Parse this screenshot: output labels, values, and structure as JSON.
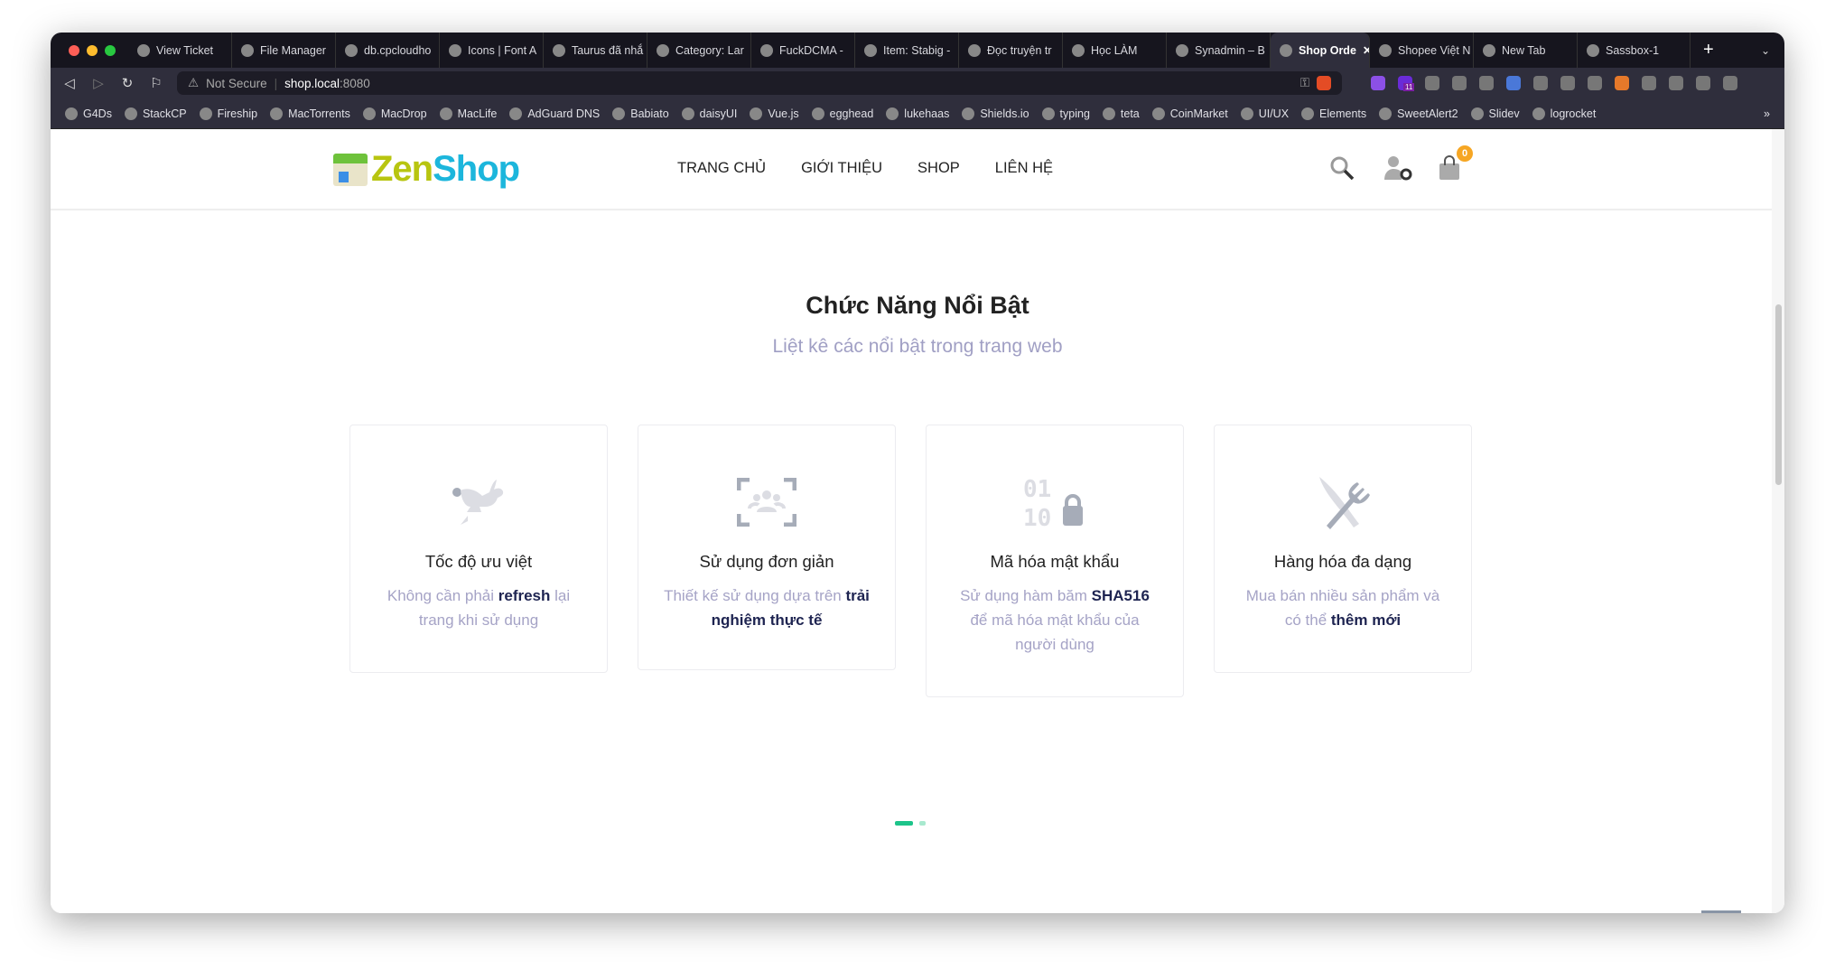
{
  "browser": {
    "tabs": [
      {
        "label": "View Ticket"
      },
      {
        "label": "File Manager"
      },
      {
        "label": "db.cpcloudho"
      },
      {
        "label": "Icons | Font A"
      },
      {
        "label": "Taurus đã nhắ"
      },
      {
        "label": "Category: Lar"
      },
      {
        "label": "FuckDCMA -"
      },
      {
        "label": "Item: Stabig -"
      },
      {
        "label": "Đọc truyện tr"
      },
      {
        "label": "Học LÀM"
      },
      {
        "label": "Synadmin – B"
      },
      {
        "label": "Shop Orde",
        "active": true
      },
      {
        "label": "Shopee Việt N"
      },
      {
        "label": "New Tab"
      },
      {
        "label": "Sassbox-1"
      }
    ],
    "security_label": "Not Secure",
    "url_host": "shop.local",
    "url_port": ":8080",
    "extension_badge": "11",
    "bookmarks": [
      "G4Ds",
      "StackCP",
      "Fireship",
      "MacTorrents",
      "MacDrop",
      "MacLife",
      "AdGuard DNS",
      "Babiato",
      "daisyUI",
      "Vue.js",
      "egghead",
      "lukehaas",
      "Shields.io",
      "typing",
      "teta",
      "CoinMarket",
      "UI/UX",
      "Elements",
      "SweetAlert2",
      "Slidev",
      "logrocket"
    ],
    "more": "»"
  },
  "site": {
    "logo": {
      "part1": "Zen",
      "part2": "Shop"
    },
    "nav": [
      "TRANG CHỦ",
      "GIỚI THIỆU",
      "SHOP",
      "LIÊN HỆ"
    ],
    "cart_count": "0",
    "section_title": "Chức Năng Nổi Bật",
    "section_subtitle": "Liệt kê các nổi bật trong trang web",
    "features": [
      {
        "icon": "rabbit-running-icon",
        "title": "Tốc độ ưu việt",
        "pre": "Không cần phải ",
        "bold": "refresh",
        "post": " lại trang khi sử dụng"
      },
      {
        "icon": "users-viewfinder-icon",
        "title": "Sử dụng đơn giản",
        "pre": "Thiết kế sử dụng dựa trên ",
        "bold": "trải nghiệm thực tế",
        "post": ""
      },
      {
        "icon": "binary-lock-icon",
        "title": "Mã hóa mật khẩu",
        "pre": "Sử dụng hàm băm ",
        "bold": "SHA516",
        "post": " để mã hóa mật khẩu của người dùng"
      },
      {
        "icon": "utensils-icon",
        "title": "Hàng hóa đa dạng",
        "pre": "Mua bán nhiều sản phẩm và có thể ",
        "bold": "thêm mới",
        "post": ""
      }
    ],
    "carousel": {
      "pages": 2,
      "active": 1
    },
    "colors": {
      "accent": "#1dc48a",
      "badge": "#f6a623",
      "emphasis": "#1e2451",
      "muted": "#a5a3c6"
    }
  }
}
